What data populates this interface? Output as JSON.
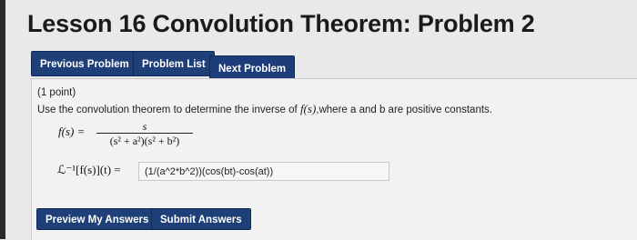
{
  "page_title": "Lesson 16 Convolution Theorem: Problem 2",
  "nav": {
    "previous": "Previous Problem",
    "list": "Problem List",
    "next": "Next Problem"
  },
  "problem": {
    "points": "(1 point)",
    "prompt_before": "Use the convolution theorem to determine the inverse of ",
    "prompt_fn": "f(s)",
    "prompt_after": ",where a and b are positive constants.",
    "f_label": "f(s) =",
    "numerator": "s",
    "denominator": "(s² + a²)(s² + b²)",
    "inverse_label": "ℒ⁻¹[f(s)](t) =",
    "answer_value": "(1/(a^2*b^2))(cos(bt)-cos(at))"
  },
  "actions": {
    "preview": "Preview My Answers",
    "submit": "Submit Answers"
  }
}
